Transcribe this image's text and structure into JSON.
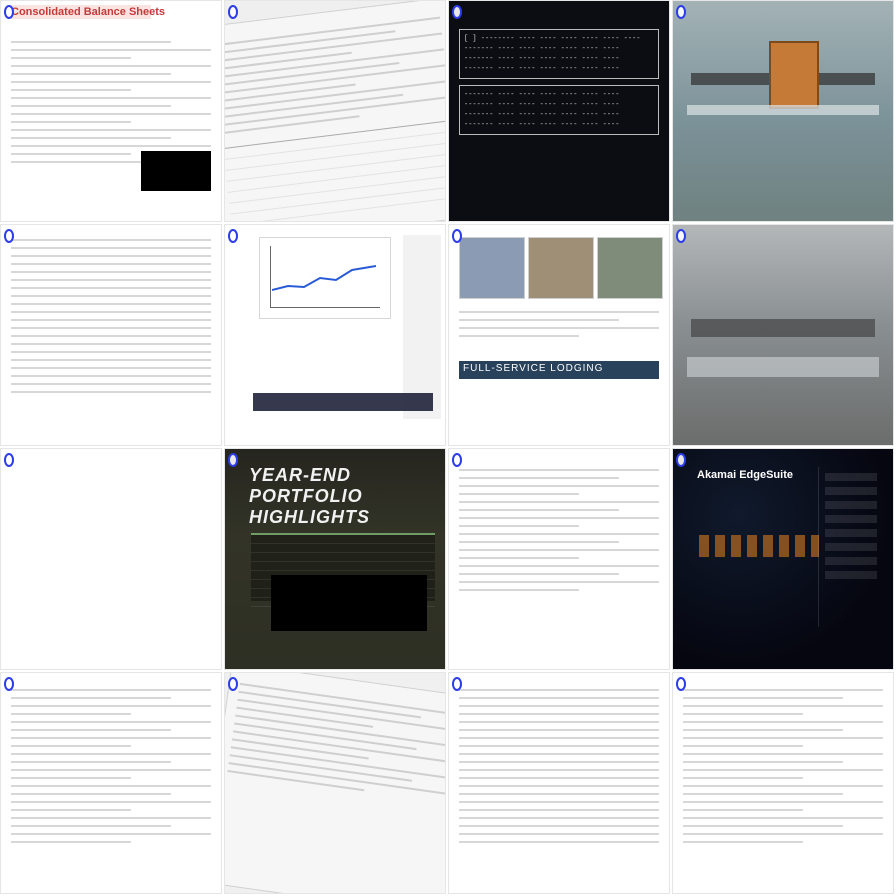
{
  "tiles": [
    {
      "label": "Consolidated Balance Sheets",
      "kind": "document",
      "accent": "#d9412f",
      "badge": "0"
    },
    {
      "label": "",
      "kind": "document-scan",
      "badge": "0"
    },
    {
      "label": "",
      "kind": "terminal-table",
      "badge": "0"
    },
    {
      "label": "",
      "kind": "photo",
      "badge": "0"
    },
    {
      "label": "",
      "kind": "document-table",
      "badge": "0"
    },
    {
      "label": "",
      "kind": "document-chart",
      "badge": "0"
    },
    {
      "label": "FULL-SERVICE LODGING",
      "kind": "brochure",
      "badge": "0"
    },
    {
      "label": "",
      "kind": "photo",
      "badge": "0"
    },
    {
      "label": "YEAR-END PORTFOLIO HIGHLIGHTS",
      "kind": "dark-document",
      "badge": "0"
    },
    {
      "label": "",
      "kind": "document",
      "badge": "0"
    },
    {
      "label": "Akamai EdgeSuite",
      "kind": "dark-ad",
      "badge": "0"
    },
    {
      "label": "",
      "kind": "document",
      "badge": "0"
    },
    {
      "label": "",
      "kind": "document",
      "badge": "0"
    },
    {
      "label": "",
      "kind": "document-scan",
      "badge": "0"
    },
    {
      "label": "",
      "kind": "document",
      "badge": "0"
    },
    {
      "label": "",
      "kind": "document",
      "badge": "0"
    }
  ]
}
